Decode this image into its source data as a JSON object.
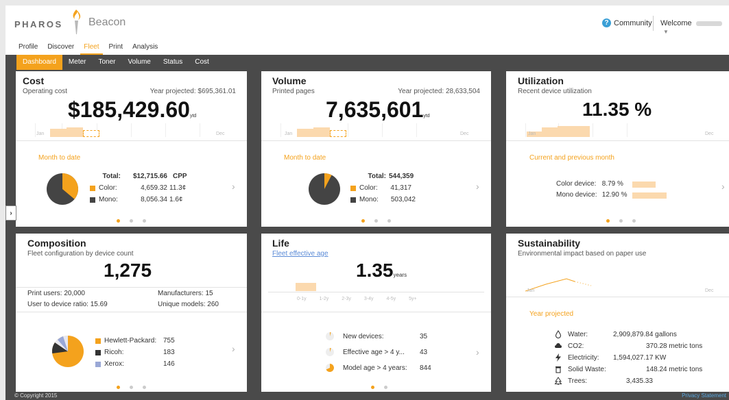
{
  "header": {
    "brand": "PHAROS",
    "product": "Beacon",
    "community": "Community",
    "welcome": "Welcome"
  },
  "main_nav": [
    "Profile",
    "Discover",
    "Fleet",
    "Print",
    "Analysis"
  ],
  "main_nav_active": "Fleet",
  "sub_nav": [
    "Dashboard",
    "Meter",
    "Toner",
    "Volume",
    "Status",
    "Cost"
  ],
  "sub_nav_active": "Dashboard",
  "panels": {
    "cost": {
      "title": "Cost",
      "subtitle": "Operating cost",
      "projected": "Year projected: $695,361.01",
      "big_value": "$185,429.60",
      "big_suffix": "ytd",
      "axis_start": "Jan",
      "axis_end": "Dec",
      "section_label": "Month to date",
      "total_label": "Total:",
      "total_value": "$12,715.66",
      "total_unit": "CPP",
      "rows": [
        {
          "label": "Color:",
          "value": "4,659.32",
          "unit": "11.3¢"
        },
        {
          "label": "Mono:",
          "value": "8,056.34",
          "unit": "1.6¢"
        }
      ]
    },
    "volume": {
      "title": "Volume",
      "subtitle": "Printed pages",
      "projected": "Year projected: 28,633,504",
      "big_value": "7,635,601",
      "big_suffix": "ytd",
      "axis_start": "Jan",
      "axis_end": "Dec",
      "section_label": "Month to date",
      "total_label": "Total:",
      "total_value": "544,359",
      "rows": [
        {
          "label": "Color:",
          "value": "41,317"
        },
        {
          "label": "Mono:",
          "value": "503,042"
        }
      ]
    },
    "utilization": {
      "title": "Utilization",
      "subtitle": "Recent device utilization",
      "big_value": "11.35 %",
      "axis_start": "Jan",
      "axis_end": "Dec",
      "section_label": "Current and previous month",
      "rows": [
        {
          "label": "Color device:",
          "value": "8.79 %",
          "pct": 8.79
        },
        {
          "label": "Mono device:",
          "value": "12.90 %",
          "pct": 12.9
        }
      ]
    },
    "composition": {
      "title": "Composition",
      "subtitle": "Fleet configuration by device count",
      "big_value": "1,275",
      "stats": [
        "Print users: 20,000",
        "Manufacturers: 15",
        "User to device ratio: 15.69",
        "Unique models: 260"
      ],
      "rows": [
        {
          "label": "Hewlett-Packard:",
          "value": "755"
        },
        {
          "label": "Ricoh:",
          "value": "183"
        },
        {
          "label": "Xerox:",
          "value": "146"
        }
      ]
    },
    "life": {
      "title": "Life",
      "subtitle_link": "Fleet effective age",
      "big_value": "1.35",
      "big_suffix": "years",
      "age_bins": [
        "0-1y",
        "1-2y",
        "2-3y",
        "3-4y",
        "4-5y",
        "5y+"
      ],
      "rows": [
        {
          "label": "New devices:",
          "value": "35"
        },
        {
          "label": "Effective age > 4 y...",
          "value": "43"
        },
        {
          "label": "Model age > 4 years:",
          "value": "844"
        }
      ]
    },
    "sustainability": {
      "title": "Sustainability",
      "subtitle": "Environmental impact based on paper use",
      "axis_start": "Jan",
      "axis_end": "Dec",
      "section_label": "Year projected",
      "rows": [
        {
          "icon": "water-drop-icon",
          "label": "Water:",
          "value": "2,909,879.84 gallons"
        },
        {
          "icon": "cloud-icon",
          "label": "CO2:",
          "value": "370.28 metric tons"
        },
        {
          "icon": "lightning-icon",
          "label": "Electricity:",
          "value": "1,594,027.17 KW"
        },
        {
          "icon": "trash-icon",
          "label": "Solid Waste:",
          "value": "148.24 metric tons"
        },
        {
          "icon": "tree-icon",
          "label": "Trees:",
          "value": "3,435.33"
        }
      ]
    }
  },
  "footer": {
    "copyright": "© Copyright 2015",
    "privacy": "Privacy Statement"
  },
  "colors": {
    "accent": "#f4a21d",
    "dark": "#4a4a4a",
    "mono": "#444444",
    "xerox": "#9aa8d6"
  }
}
